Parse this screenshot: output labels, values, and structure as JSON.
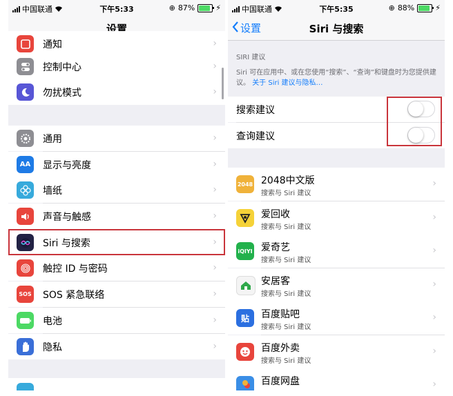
{
  "left": {
    "status": {
      "carrier": "中国联通",
      "time": "下午5:33",
      "battery": "87%",
      "battery_level": 0.87
    },
    "title": "设置",
    "rows": [
      {
        "label": "通知",
        "icon": "notification-icon",
        "color": "#e8453c"
      },
      {
        "label": "控制中心",
        "icon": "toggles-icon",
        "color": "#8e8e93"
      },
      {
        "label": "勿扰模式",
        "icon": "moon-icon",
        "color": "#5856d6"
      },
      {
        "label": "通用",
        "icon": "gear-icon",
        "color": "#8e8e93"
      },
      {
        "label": "显示与亮度",
        "icon": "text-size-icon",
        "color": "#1e7be6",
        "glyph": "AA"
      },
      {
        "label": "墙纸",
        "icon": "flower-icon",
        "color": "#37aadc"
      },
      {
        "label": "声音与触感",
        "icon": "speaker-icon",
        "color": "#e8453c"
      },
      {
        "label": "Siri 与搜索",
        "icon": "siri-icon",
        "color": "#222244"
      },
      {
        "label": "触控 ID 与密码",
        "icon": "fingerprint-icon",
        "color": "#e8453c"
      },
      {
        "label": "SOS 紧急联络",
        "icon": "sos-icon",
        "color": "#e8453c",
        "glyph": "SOS"
      },
      {
        "label": "电池",
        "icon": "battery-icon",
        "color": "#4cd964"
      },
      {
        "label": "隐私",
        "icon": "hand-icon",
        "color": "#3a6fd8"
      }
    ]
  },
  "right": {
    "status": {
      "carrier": "中国联通",
      "time": "下午5:35",
      "battery": "88%",
      "battery_level": 0.88
    },
    "back": "设置",
    "title": "Siri 与搜索",
    "section_header": "SIRI 建议",
    "description": "Siri 可在应用中、或在您使用“搜索”、“查询”和键盘时为您提供建议。",
    "description_link": "关于 Siri 建议与隐私…",
    "toggles": [
      {
        "label": "搜索建议",
        "on": false
      },
      {
        "label": "查询建议",
        "on": false
      }
    ],
    "apps": [
      {
        "name": "2048中文版",
        "sub": "搜索与 Siri 建议",
        "icon": "game-2048-icon",
        "color": "#f0b23a",
        "glyph": "2048"
      },
      {
        "name": "爱回收",
        "sub": "搜索与 Siri 建议",
        "icon": "aihuishou-icon",
        "color": "#f5d238"
      },
      {
        "name": "爱奇艺",
        "sub": "搜索与 Siri 建议",
        "icon": "iqiyi-icon",
        "color": "#22b14c",
        "glyph": "iQIYI"
      },
      {
        "name": "安居客",
        "sub": "搜索与 Siri 建议",
        "icon": "house-icon",
        "color": "#f4f4f4"
      },
      {
        "name": "百度贴吧",
        "sub": "搜索与 Siri 建议",
        "icon": "tieba-icon",
        "color": "#2b6fe0",
        "glyph": "贴"
      },
      {
        "name": "百度外卖",
        "sub": "搜索与 Siri 建议",
        "icon": "waimai-icon",
        "color": "#e8453c"
      },
      {
        "name": "百度网盘",
        "sub": "",
        "icon": "cloud-drive-icon",
        "color": "#3a8ee6"
      }
    ]
  }
}
